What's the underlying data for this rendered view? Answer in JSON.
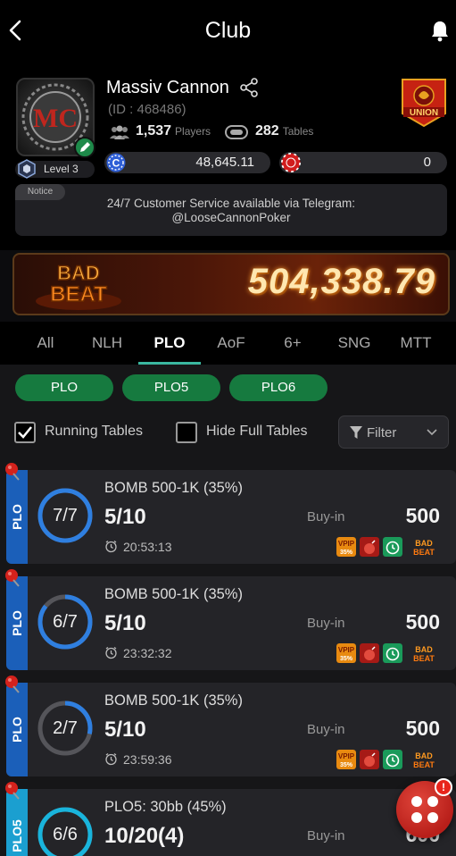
{
  "header": {
    "title": "Club"
  },
  "club": {
    "name": "Massiv Cannon",
    "id_text": "(ID : 468486)",
    "players_count": "1,537",
    "players_label": "Players",
    "tables_count": "282",
    "tables_label": "Tables",
    "level": "Level 3",
    "balance_chips": "48,645.11",
    "balance_other": "0",
    "union_label": "UNION"
  },
  "notice": {
    "tag": "Notice",
    "text": "24/7 Customer Service available via Telegram: @LooseCannonPoker"
  },
  "banner": {
    "logo_line1": "BAD",
    "logo_line2": "BEAT",
    "amount": "504,338.79"
  },
  "tabs": [
    {
      "label": "All",
      "active": false
    },
    {
      "label": "NLH",
      "active": false
    },
    {
      "label": "PLO",
      "active": true
    },
    {
      "label": "AoF",
      "active": false
    },
    {
      "label": "6+",
      "active": false
    },
    {
      "label": "SNG",
      "active": false
    },
    {
      "label": "MTT",
      "active": false
    }
  ],
  "subfilters": [
    "PLO",
    "PLO5",
    "PLO6"
  ],
  "options": {
    "running_tables": {
      "label": "Running Tables",
      "checked": true
    },
    "hide_full": {
      "label": "Hide Full Tables",
      "checked": false
    },
    "filter_label": "Filter"
  },
  "tables": [
    {
      "tag": "PLO",
      "name": "BOMB 500-1K (35%)",
      "seats": "7/7",
      "fill": 1.0,
      "blinds": "5/10",
      "time": "20:53:13",
      "buyin_label": "Buy-in",
      "buyin": "500",
      "vpip": "VPIP",
      "vpip_pct": "35%"
    },
    {
      "tag": "PLO",
      "name": "BOMB 500-1K (35%)",
      "seats": "6/7",
      "fill": 0.857,
      "blinds": "5/10",
      "time": "23:32:32",
      "buyin_label": "Buy-in",
      "buyin": "500",
      "vpip": "VPIP",
      "vpip_pct": "35%"
    },
    {
      "tag": "PLO",
      "name": "BOMB 500-1K (35%)",
      "seats": "2/7",
      "fill": 0.286,
      "blinds": "5/10",
      "time": "23:59:36",
      "buyin_label": "Buy-in",
      "buyin": "500",
      "vpip": "VPIP",
      "vpip_pct": "35%"
    },
    {
      "tag": "PLO5",
      "name": "PLO5: 30bb (45%)",
      "seats": "6/6",
      "fill": 1.0,
      "blinds": "10/20(4)",
      "time": "",
      "buyin_label": "Buy-in",
      "buyin": "600",
      "vpip": "",
      "vpip_pct": ""
    }
  ],
  "fab": {
    "alert": "!"
  },
  "colors": {
    "accent": "#3ab7a0",
    "pill_green": "#167a3f",
    "ring_blue": "#2f7fe0",
    "tag_blue": "#1b5fb9",
    "tag_teal": "#1b9fd0"
  }
}
